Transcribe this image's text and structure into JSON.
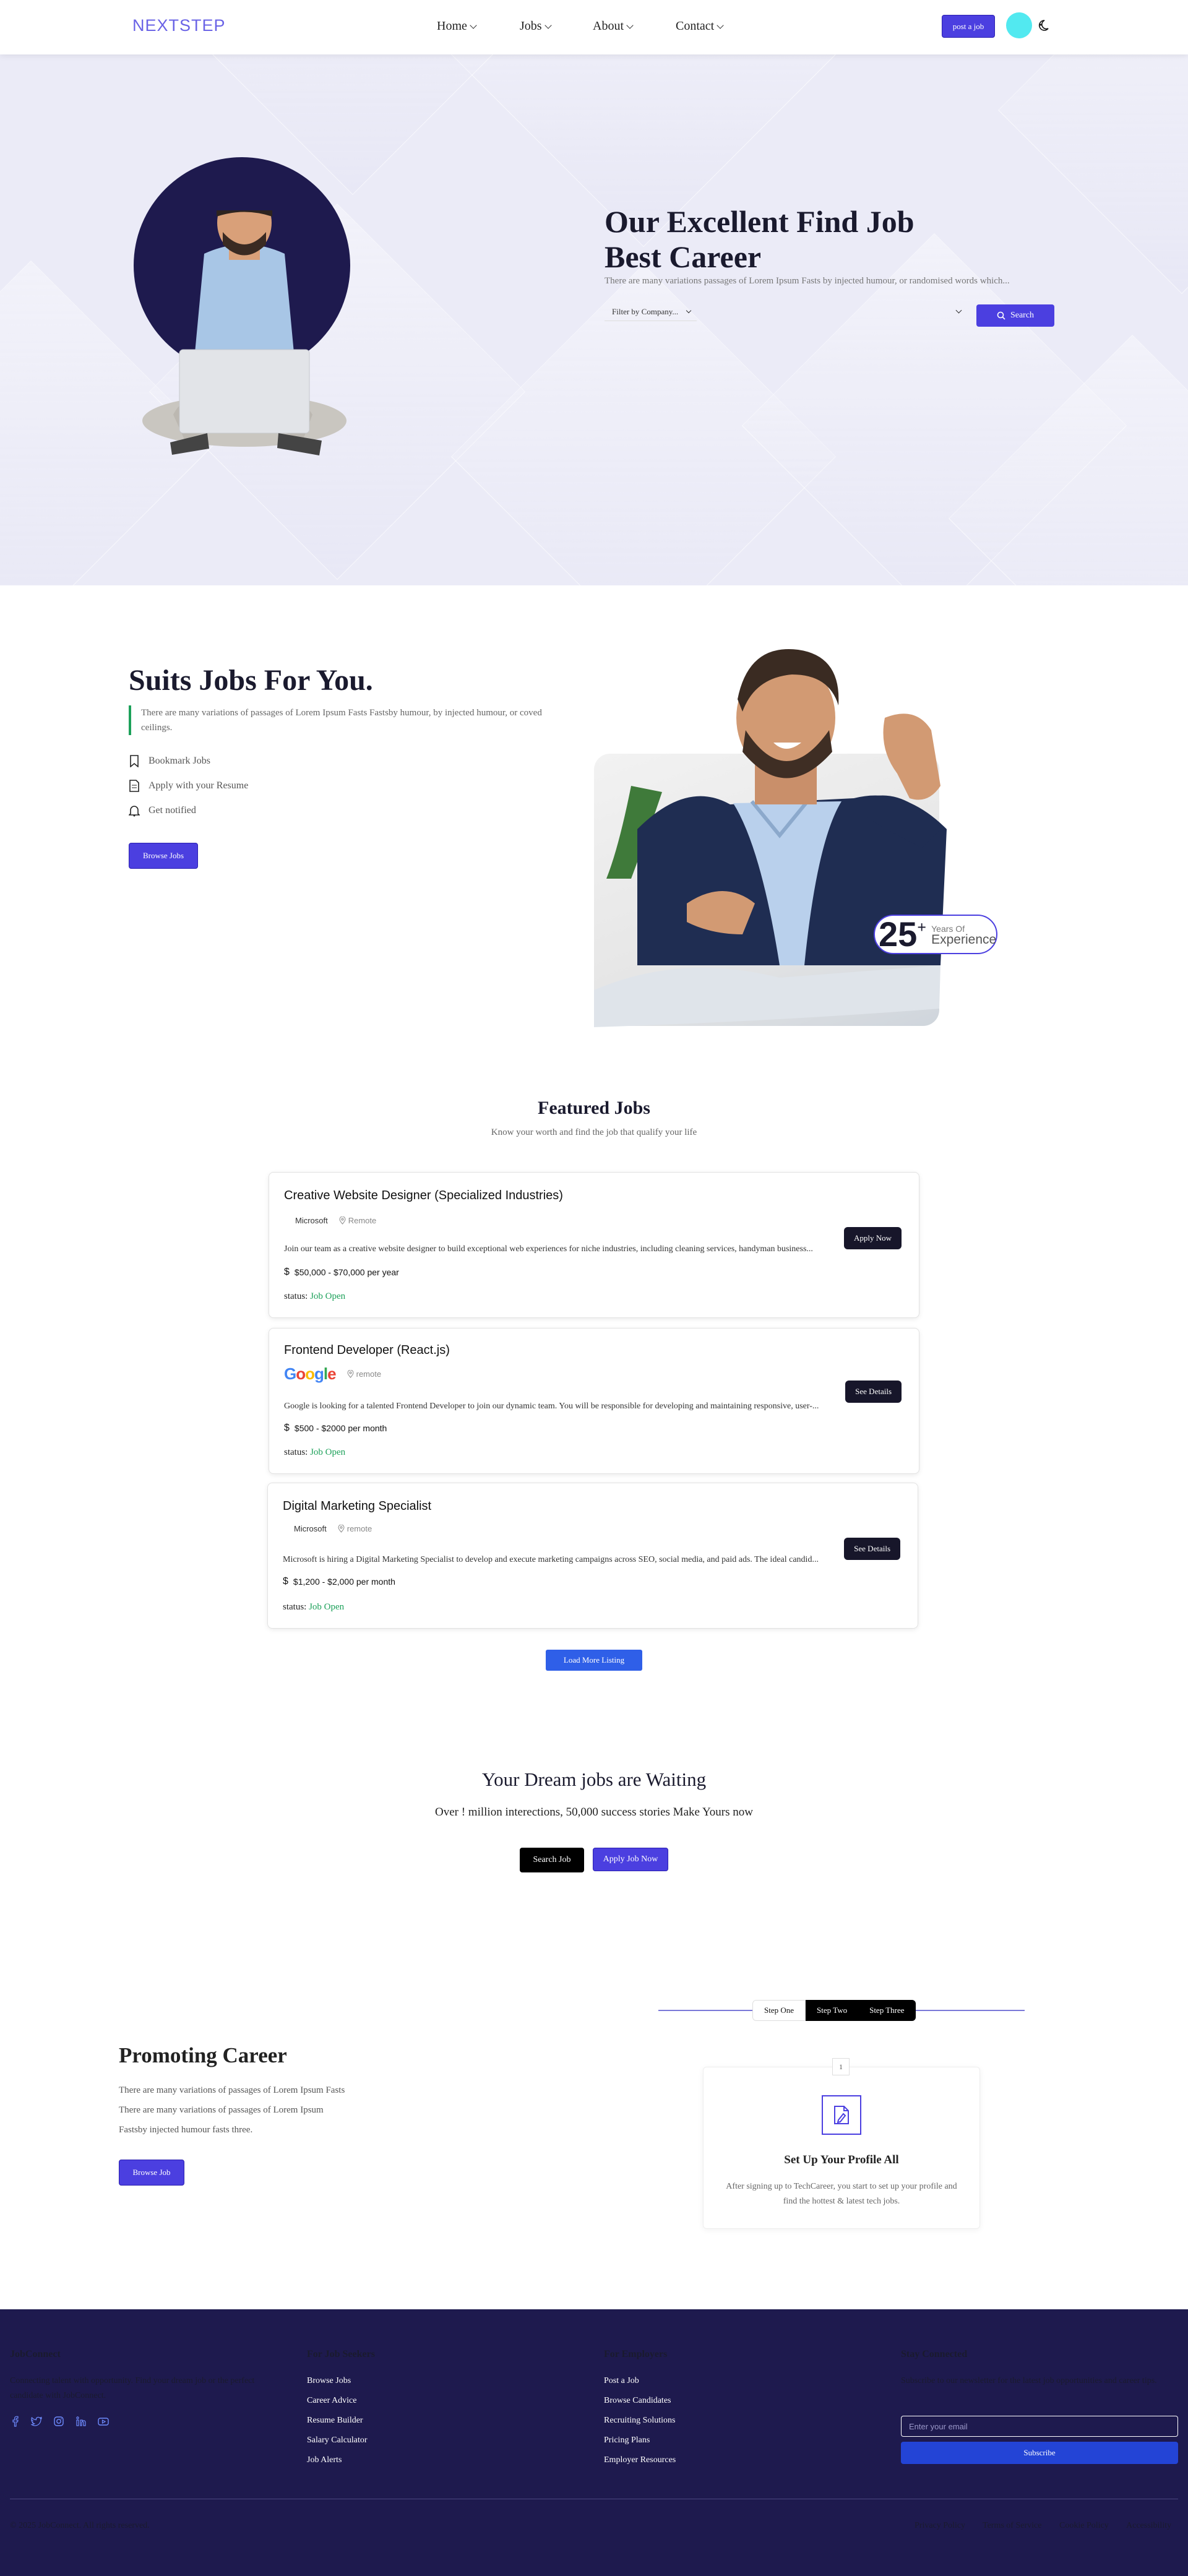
{
  "nav": {
    "logo": "NEXTSTEP",
    "items": [
      {
        "label": "Home"
      },
      {
        "label": "Jobs"
      },
      {
        "label": "About"
      },
      {
        "label": "Contact"
      }
    ],
    "post_job": "post a job",
    "theme_icon": "moon-icon",
    "avatar_color": "#52e9f0"
  },
  "hero": {
    "title": "Our Excellent Find Job Best Career",
    "subtitle": "There are many variations passages of Lorem Ipsum Fasts by injected humour, or randomised words which...",
    "filter_placeholder": "Filter by Company...",
    "search_label": "Search"
  },
  "suits": {
    "title": "Suits Jobs For You.",
    "description": "There are many variations of passages of Lorem Ipsum Fasts Fastsby humour, by injected humour, or coved ceilings.",
    "features": [
      {
        "icon": "bookmark-icon",
        "label": "Bookmark Jobs"
      },
      {
        "icon": "resume-icon",
        "label": "Apply with your Resume"
      },
      {
        "icon": "bell-icon",
        "label": "Get notified"
      }
    ],
    "button": "Browse Jobs",
    "experience_number": "25",
    "experience_plus": "+",
    "experience_top": "Years Of",
    "experience_bottom": "Experience"
  },
  "featured": {
    "title": "Featured Jobs",
    "subtitle": "Know your worth and find the job that qualify your life",
    "jobs": [
      {
        "title": "Creative Website Designer (Specialized Industries)",
        "company": "Microsoft",
        "location": "Remote",
        "description": "Join our team as a creative website designer to build exceptional web experiences for niche industries, including cleaning services, handyman business...",
        "salary": "$50,000 - $70,000 per year",
        "status_label": "status:",
        "status": "Job Open",
        "action": "Apply Now"
      },
      {
        "title": "Frontend Developer (React.js)",
        "company": "Google",
        "location": "remote",
        "description": "Google is looking for a talented Frontend Developer to join our dynamic team. You will be responsible for developing and maintaining responsive, user-...",
        "salary": "$500 - $2000 per month",
        "status_label": "status:",
        "status": "Job Open",
        "action": "See Details"
      },
      {
        "title": "Digital Marketing Specialist",
        "company": "Microsoft",
        "location": "remote",
        "description": "Microsoft is hiring a Digital Marketing Specialist to develop and execute marketing campaigns across SEO, social media, and paid ads. The ideal candid...",
        "salary": "$1,200 - $2,000 per month",
        "status_label": "status:",
        "status": "Job Open",
        "action": "See Details"
      }
    ],
    "load_more": "Load More Listing"
  },
  "dream": {
    "title": "Your Dream jobs are Waiting",
    "subtitle": "Over ! million interections, 50,000 success stories Make Yours now",
    "search": "Search Job",
    "apply": "Apply Job Now"
  },
  "promote": {
    "steps": [
      "Step One",
      "Step Two",
      "Step Three"
    ],
    "title": "Promoting Career",
    "lines": [
      "There are many variations of passages of Lorem Ipsum Fasts",
      "There are many variations of passages of Lorem Ipsum",
      "Fastsby injected humour fasts three."
    ],
    "button": "Browse Job",
    "card_number": "1",
    "card_title": "Set Up Your Profile All",
    "card_desc": "After signing up to TechCareer, you start to set up your profile and find the hottest & latest tech jobs."
  },
  "footer": {
    "brand": "JobConnect",
    "tagline": "Connecting talent with opportunity. Find your dream job or the perfect candidate with JobConnect.",
    "socials": [
      "facebook-icon",
      "twitter-icon",
      "instagram-icon",
      "linkedin-icon",
      "youtube-icon"
    ],
    "seekers_title": "For Job Seekers",
    "seekers": [
      "Browse Jobs",
      "Career Advice",
      "Resume Builder",
      "Salary Calculator",
      "Job Alerts"
    ],
    "employers_title": "For Employers",
    "employers": [
      "Post a Job",
      "Browse Candidates",
      "Recruiting Solutions",
      "Pricing Plans",
      "Employer Resources"
    ],
    "newsletter_title": "Stay Connected",
    "newsletter_desc": "Subscribe to our newsletter for the latest job opportunities and career tips.",
    "newsletter_placeholder": "Enter your email",
    "subscribe": "Subscribe",
    "copyright": "© 2025 JobConnect. All rights reserved.",
    "bottom_links": [
      "Privacy Policy",
      "Terms of Service",
      "Cookie Policy",
      "Accessibility"
    ]
  },
  "colors": {
    "accent": "#4b3fe0",
    "footer_bg": "#1e1a4e",
    "status_green": "#1da15a",
    "hero_bg": "#ebebf7"
  }
}
